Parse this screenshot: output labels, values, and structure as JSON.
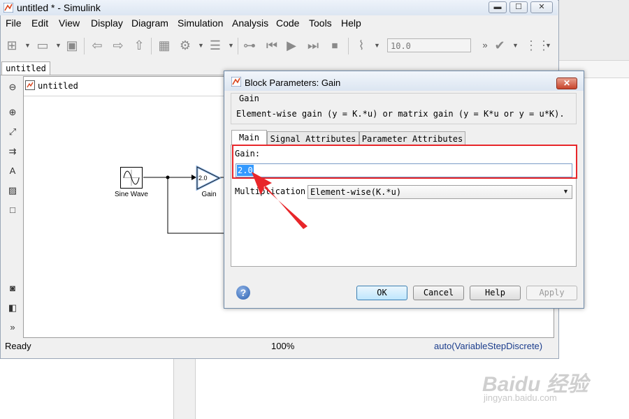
{
  "window": {
    "title": "untitled * - Simulink",
    "controls": {
      "minimize": "▬",
      "maximize": "☐",
      "close": "✕"
    }
  },
  "menubar": [
    "File",
    "Edit",
    "View",
    "Display",
    "Diagram",
    "Simulation",
    "Analysis",
    "Code",
    "Tools",
    "Help"
  ],
  "toolbar": {
    "stop_time": "10.0",
    "more": "»"
  },
  "tabs": {
    "model_tab": "untitled"
  },
  "breadcrumb": {
    "model": "untitled"
  },
  "palette_icons": [
    "fit-view-icon",
    "zoom-icon",
    "fit-to-view-icon",
    "arrow-icon",
    "annotation-icon",
    "image-icon",
    "area-icon",
    "screenshot-icon",
    "model-browser-icon"
  ],
  "palette": {
    "expand": "»"
  },
  "diagram": {
    "blocks": [
      {
        "name": "Sine Wave"
      },
      {
        "name": "Gain",
        "value": "2.0"
      }
    ]
  },
  "statusbar": {
    "status": "Ready",
    "zoom": "100%",
    "solver": "auto(VariableStepDiscrete)"
  },
  "dialog": {
    "title": "Block Parameters: Gain",
    "close": "✕",
    "group_title": "Gain",
    "description": "Element-wise gain (y = K.*u) or matrix gain (y = K*u or y = u*K).",
    "tabs": [
      "Main",
      "Signal Attributes",
      "Parameter Attributes"
    ],
    "gain_label": "Gain:",
    "gain_value": "2.0",
    "multiplication_label": "Multiplication:",
    "multiplication_value": "Element-wise(K.*u)",
    "buttons": {
      "ok": "OK",
      "cancel": "Cancel",
      "help": "Help",
      "apply": "Apply"
    },
    "help_icon": "?"
  },
  "annotation": {
    "highlight_color": "#e8262a"
  },
  "watermark": {
    "brand": "Baidu 经验",
    "url": "jingyan.baidu.com"
  }
}
